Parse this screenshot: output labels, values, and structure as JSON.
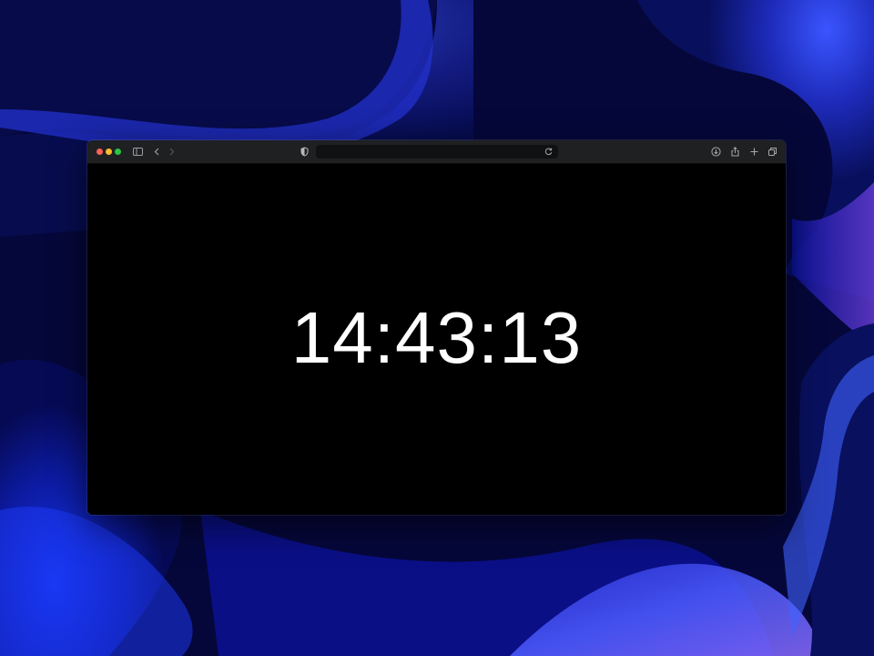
{
  "desktop": {
    "wallpaper_colors": [
      "#05073a",
      "#1b2bd6",
      "#3a52ff",
      "#7b3fe0",
      "#0a0f8a"
    ]
  },
  "browser": {
    "traffic_lights": {
      "close_color": "#ff5f57",
      "minimize_color": "#febc2e",
      "zoom_color": "#28c840"
    },
    "icons": {
      "sidebar": "sidebar-icon",
      "back": "chevron-left-icon",
      "forward": "chevron-right-icon",
      "privacy": "shield-icon",
      "reload": "reload-icon",
      "downloads": "download-icon",
      "share": "share-icon",
      "new_tab": "plus-icon",
      "tabs_overview": "tabs-icon"
    },
    "address_bar": {
      "value": ""
    }
  },
  "page": {
    "background_color": "#000000",
    "clock_text": "14:43:13",
    "clock_color": "#ffffff"
  }
}
